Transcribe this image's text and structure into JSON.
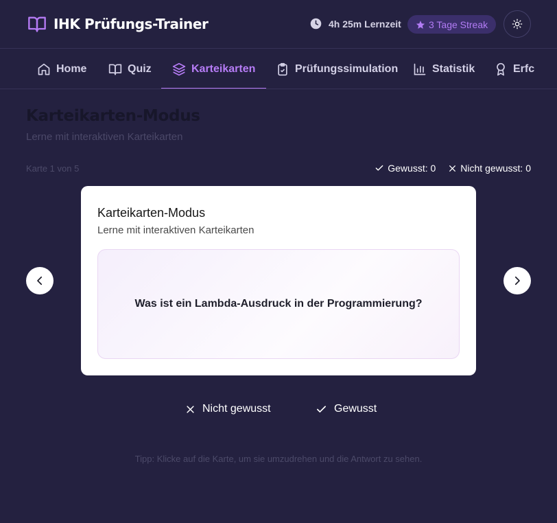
{
  "app": {
    "title": "IHK Prüfungs-Trainer",
    "study_time": "4h 25m Lernzeit",
    "streak": "3 Tage Streak",
    "accent_color": "#b67cf6",
    "background_color": "#242140"
  },
  "nav": {
    "tabs": [
      {
        "label": "Home",
        "icon": "home-icon",
        "active": false
      },
      {
        "label": "Quiz",
        "icon": "book-open-icon",
        "active": false
      },
      {
        "label": "Karteikarten",
        "icon": "layers-icon",
        "active": true
      },
      {
        "label": "Prüfungssimulation",
        "icon": "clipboard-check-icon",
        "active": false
      },
      {
        "label": "Statistik",
        "icon": "bar-chart-icon",
        "active": false
      },
      {
        "label": "Erfc",
        "icon": "award-icon",
        "active": false
      }
    ]
  },
  "page": {
    "title": "Karteikarten-Modus",
    "subtitle": "Lerne mit interaktiven Karteikarten",
    "card_count": "Karte 1 von 5",
    "known_label": "Gewusst: 0",
    "unknown_label": "Nicht gewusst: 0"
  },
  "card": {
    "title": "Karteikarten-Modus",
    "subtitle": "Lerne mit interaktiven Karteikarten",
    "question": "Was ist ein Lambda-Ausdruck in der Programmierung?"
  },
  "actions": {
    "not_known": "Nicht gewusst",
    "known": "Gewusst"
  },
  "tip": "Tipp: Klicke auf die Karte, um sie umzudrehen und die Antwort zu sehen."
}
